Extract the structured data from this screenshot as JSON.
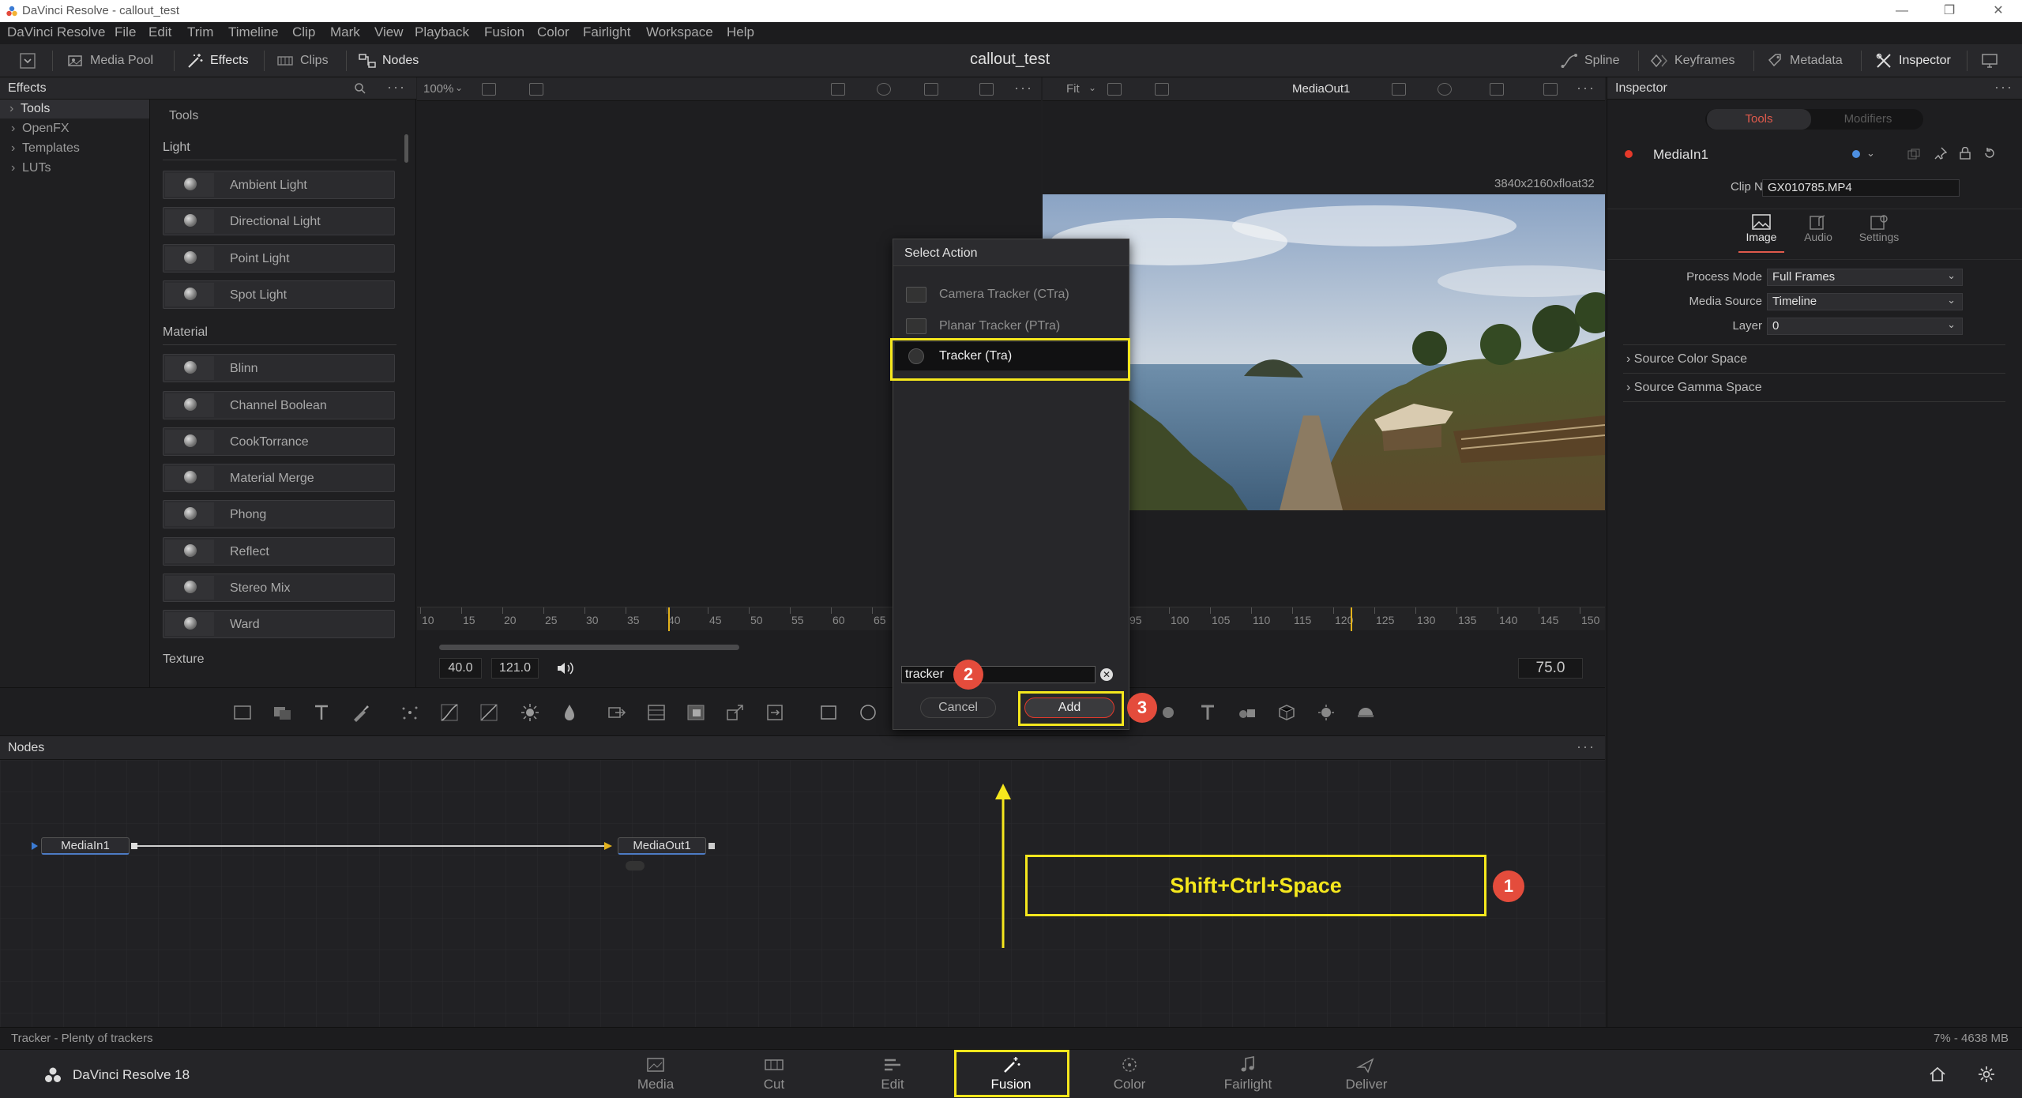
{
  "window": {
    "title": "DaVinci Resolve - callout_test"
  },
  "menu": [
    "DaVinci Resolve",
    "File",
    "Edit",
    "Trim",
    "Timeline",
    "Clip",
    "Mark",
    "View",
    "Playback",
    "Fusion",
    "Color",
    "Fairlight",
    "Workspace",
    "Help"
  ],
  "toolbar": {
    "media_pool": "Media Pool",
    "effects": "Effects",
    "clips": "Clips",
    "nodes": "Nodes",
    "project_title": "callout_test",
    "spline": "Spline",
    "keyframes": "Keyframes",
    "metadata": "Metadata",
    "inspector": "Inspector"
  },
  "effects_panel": {
    "title": "Effects",
    "tree": [
      "Tools",
      "OpenFX",
      "Templates",
      "LUTs"
    ],
    "tools_heading": "Tools",
    "sections": [
      {
        "title": "Light",
        "items": [
          "Ambient Light",
          "Directional Light",
          "Point Light",
          "Spot Light"
        ]
      },
      {
        "title": "Material",
        "items": [
          "Blinn",
          "Channel Boolean",
          "CookTorrance",
          "Material Merge",
          "Phong",
          "Reflect",
          "Stereo Mix",
          "Ward"
        ]
      },
      {
        "title": "Texture",
        "items": []
      }
    ]
  },
  "viewer_left": {
    "zoom": "100%",
    "ruler": [
      "10",
      "15",
      "20",
      "25",
      "30",
      "35",
      "40",
      "45",
      "50",
      "55",
      "60",
      "65"
    ],
    "start": "40.0",
    "end": "121.0"
  },
  "viewer_right": {
    "zoom": "Fit",
    "node_name": "MediaOut1",
    "resolution": "3840x2160xfloat32",
    "ruler": [
      "95",
      "100",
      "105",
      "110",
      "115",
      "120",
      "125",
      "130",
      "135",
      "140",
      "145",
      "150"
    ],
    "frame": "75.0"
  },
  "dialog": {
    "title": "Select Action",
    "items": [
      "Camera Tracker (CTra)",
      "Planar Tracker (PTra)",
      "Tracker (Tra)"
    ],
    "selected_index": 2,
    "search_value": "tracker",
    "cancel": "Cancel",
    "add": "Add"
  },
  "nodes_panel": {
    "title": "Nodes",
    "node_in": "MediaIn1",
    "node_out": "MediaOut1"
  },
  "inspector": {
    "title": "Inspector",
    "tabs": [
      "Tools",
      "Modifiers"
    ],
    "node_name": "MediaIn1",
    "clip_name_label": "Clip Name",
    "clip_name": "GX010785.MP4",
    "subtabs": [
      "Image",
      "Audio",
      "Settings"
    ],
    "process_mode_label": "Process Mode",
    "process_mode": "Full Frames",
    "media_source_label": "Media Source",
    "media_source": "Timeline",
    "layer_label": "Layer",
    "layer": "0",
    "source_color_space": "Source Color Space",
    "source_gamma_space": "Source Gamma Space"
  },
  "status": {
    "left": "Tracker - Plenty of trackers",
    "right": "7% - 4638 MB"
  },
  "pagebar": {
    "app": "DaVinci Resolve 18",
    "pages": [
      "Media",
      "Cut",
      "Edit",
      "Fusion",
      "Color",
      "Fairlight",
      "Deliver"
    ],
    "active": "Fusion"
  },
  "callouts": {
    "shortcut": "Shift+Ctrl+Space",
    "badge1": "1",
    "badge2": "2",
    "badge3": "3",
    "color": "#f5e71d",
    "badge_color": "#e44c3c"
  }
}
